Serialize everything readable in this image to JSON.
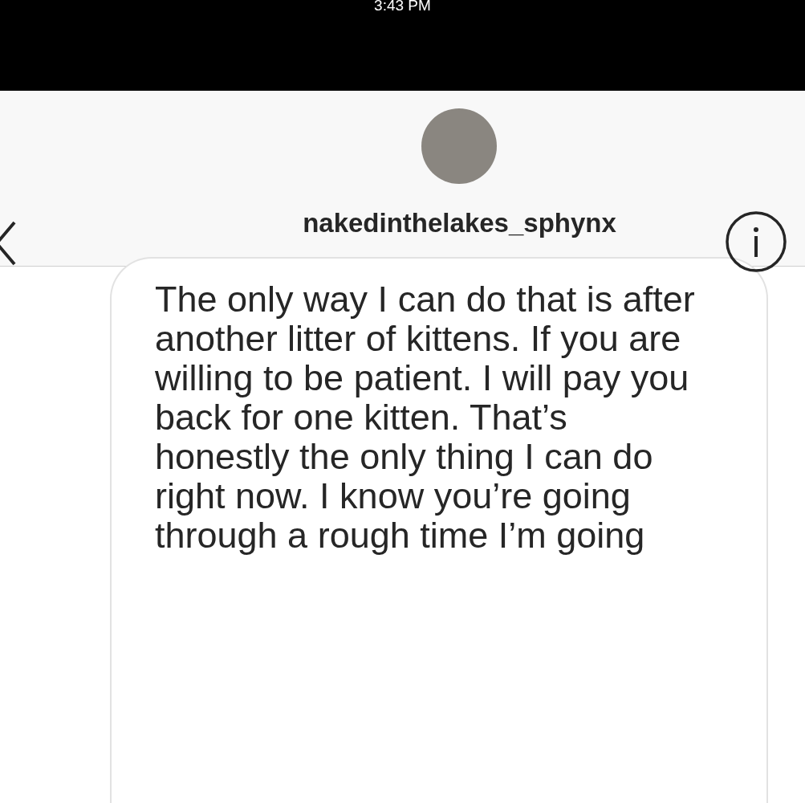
{
  "status_bar": {
    "time": "3:43 PM"
  },
  "header": {
    "username": "nakedinthelakes_sphynx"
  },
  "messages": [
    {
      "text": "The only way I can do that is after another litter of kittens. If you are willing to be patient. I will pay you back for one kitten. That’s honestly the only thing I can do right now. I know you’re going through a rough time I’m going"
    }
  ]
}
